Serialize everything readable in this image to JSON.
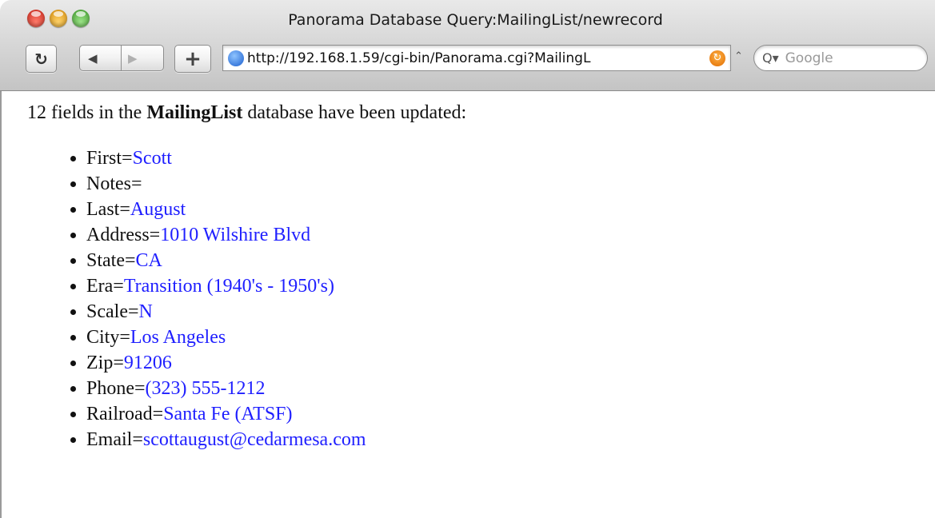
{
  "window": {
    "title": "Panorama Database Query:MailingList/newrecord"
  },
  "toolbar": {
    "reload_glyph": "↻",
    "back_glyph": "◀",
    "forward_glyph": "▶",
    "add_glyph": "+",
    "url": "http://192.168.1.59/cgi-bin/Panorama.cgi?MailingL",
    "search_placeholder": "Google",
    "search_glyph": "Q▾",
    "rss_glyph": "↻",
    "resize_glyph": "⌃"
  },
  "content": {
    "summary_prefix": "12 fields in the ",
    "database_name": "MailingList",
    "summary_suffix": " database have been updated:",
    "fields": [
      {
        "name": "First=",
        "value": "Scott"
      },
      {
        "name": "Notes=",
        "value": ""
      },
      {
        "name": "Last=",
        "value": "August"
      },
      {
        "name": "Address=",
        "value": "1010 Wilshire Blvd"
      },
      {
        "name": "State=",
        "value": "CA"
      },
      {
        "name": "Era=",
        "value": "Transition (1940's - 1950's)"
      },
      {
        "name": "Scale=",
        "value": "N"
      },
      {
        "name": "City=",
        "value": "Los Angeles"
      },
      {
        "name": "Zip=",
        "value": "91206"
      },
      {
        "name": "Phone=",
        "value": "(323) 555-1212"
      },
      {
        "name": "Railroad=",
        "value": "Santa Fe (ATSF)"
      },
      {
        "name": "Email=",
        "value": "scottaugust@cedarmesa.com"
      }
    ]
  },
  "colors": {
    "value_text": "#1f1fff",
    "close_button": "#c8261a",
    "minimize_button": "#d58c0b",
    "zoom_button": "#3d9a2a"
  }
}
